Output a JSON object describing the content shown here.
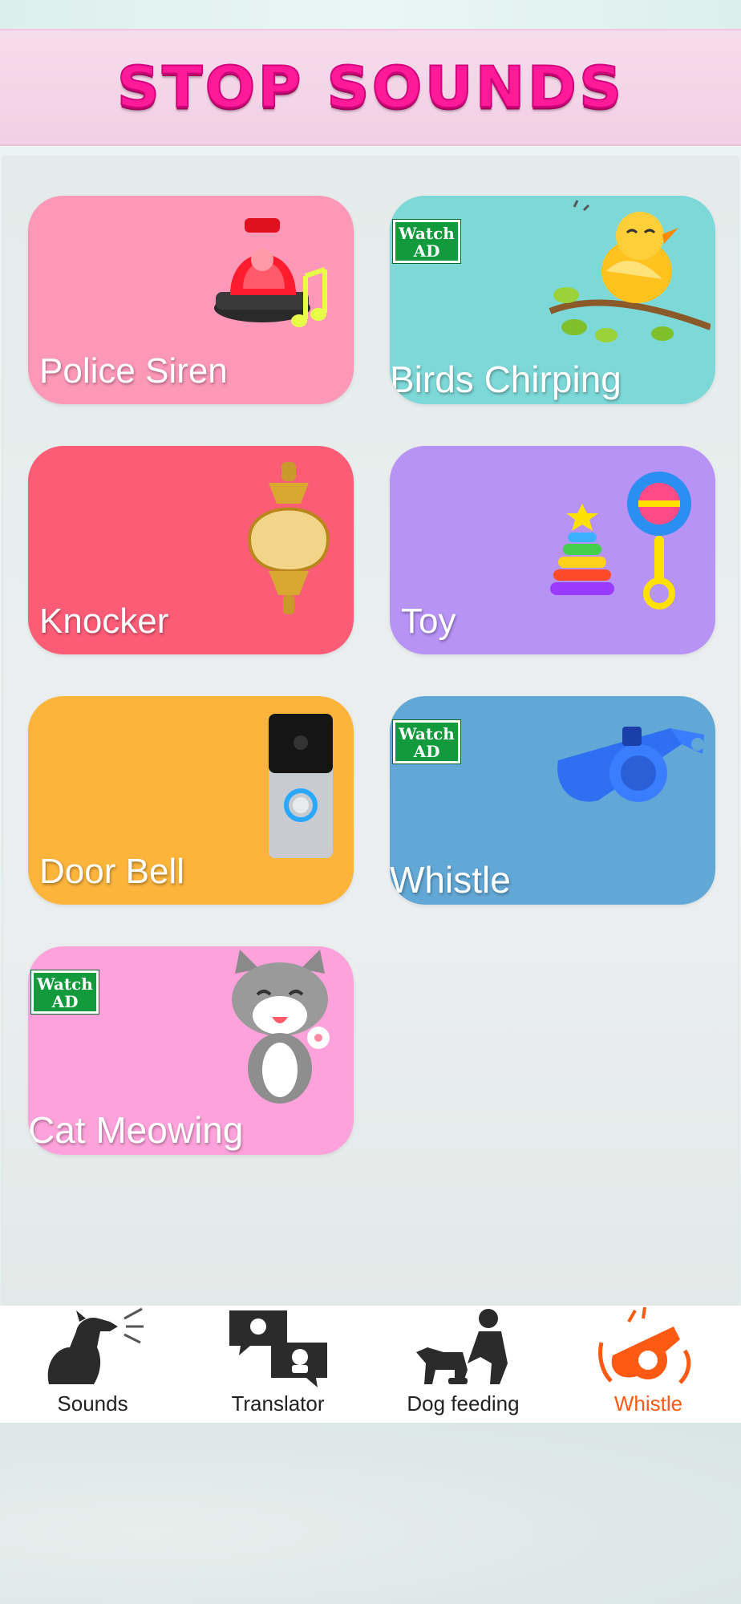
{
  "header": {
    "title": "STOP SOUNDS"
  },
  "cards": [
    {
      "label": "Police Siren",
      "color": "#fd98b8",
      "watch_ad": false,
      "icon": "police-siren-icon"
    },
    {
      "label": "Birds Chirping",
      "color": "#7dd8d8",
      "watch_ad": true,
      "icon": "bird-icon"
    },
    {
      "label": "Knocker",
      "color": "#fd5c77",
      "watch_ad": false,
      "icon": "door-knocker-icon"
    },
    {
      "label": "Toy",
      "color": "#b793f5",
      "watch_ad": false,
      "icon": "toy-icon"
    },
    {
      "label": "Door Bell",
      "color": "#fcb43b",
      "watch_ad": false,
      "icon": "doorbell-icon"
    },
    {
      "label": "Whistle",
      "color": "#62a8d7",
      "watch_ad": true,
      "icon": "whistle-icon"
    },
    {
      "label": "Cat Meowing",
      "color": "#fea2db",
      "watch_ad": true,
      "icon": "cat-icon"
    }
  ],
  "watch_ad": {
    "line1": "Watch",
    "line2": "AD"
  },
  "bottom_nav": [
    {
      "label": "Sounds",
      "icon": "barking-dog-icon",
      "active": false
    },
    {
      "label": "Translator",
      "icon": "translator-icon",
      "active": false
    },
    {
      "label": "Dog feeding",
      "icon": "dog-feeding-icon",
      "active": false
    },
    {
      "label": "Whistle",
      "icon": "whistle-icon",
      "active": true
    }
  ],
  "colors": {
    "active_tab": "#ff5a14",
    "title": "#ff1a9a",
    "ad_badge": "#139a3c"
  }
}
